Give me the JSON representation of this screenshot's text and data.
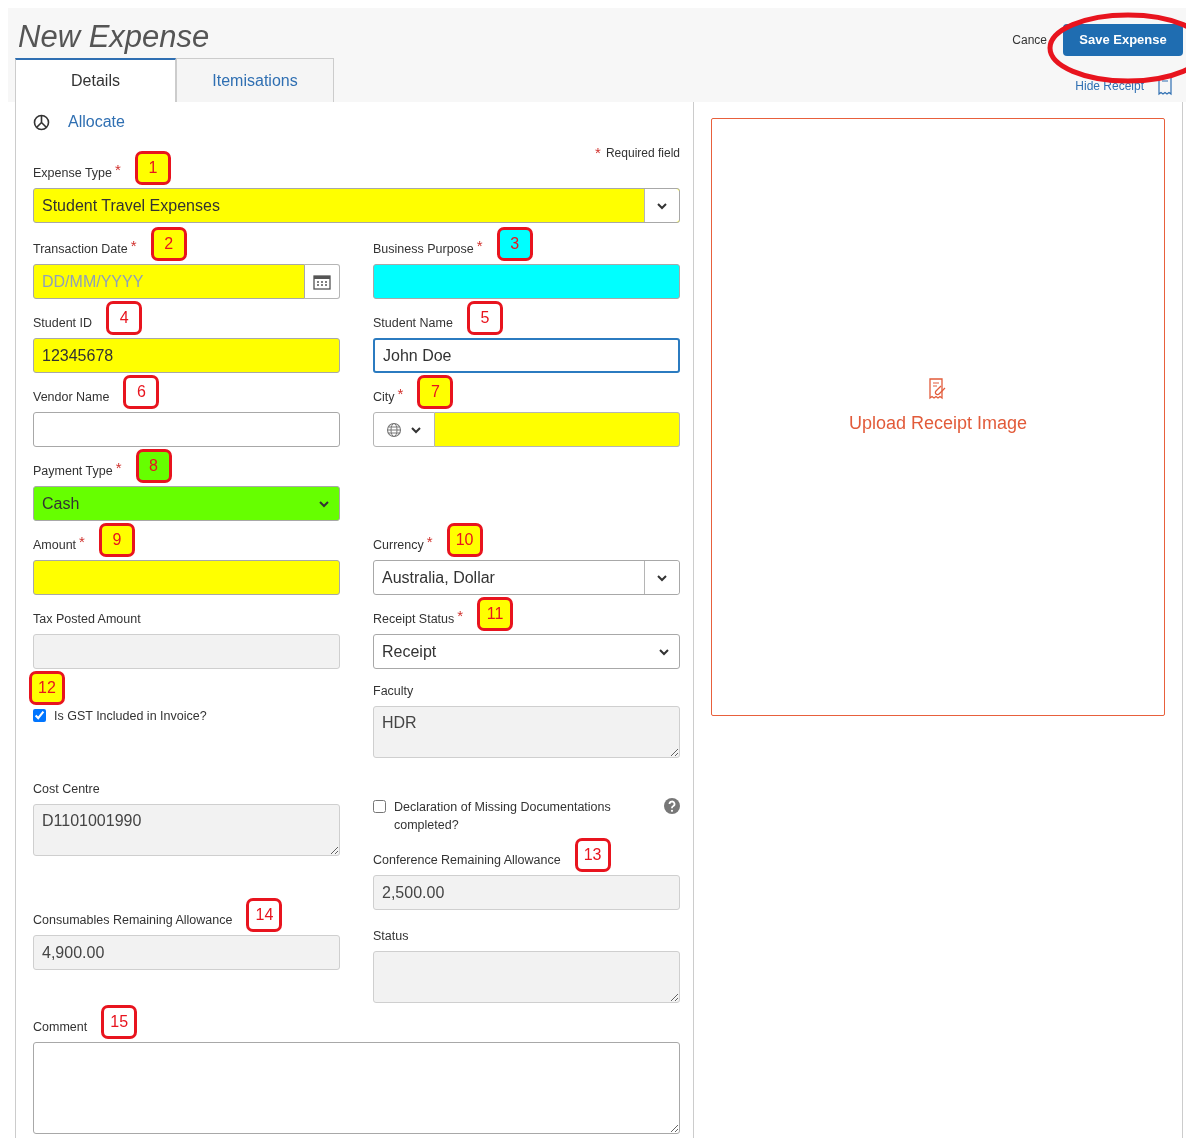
{
  "header": {
    "title": "New Expense",
    "cancel": "Cance",
    "save": {
      "label": "Save Expense",
      "circled": true
    },
    "hide_receipt": "Hide Receipt"
  },
  "tabs": [
    {
      "label": "Details",
      "selected": true
    },
    {
      "label": "Itemisations",
      "selected": false
    }
  ],
  "allocate": "Allocate",
  "required_note": {
    "asterisk": "*",
    "text": "Required field"
  },
  "form": {
    "top": [
      {
        "label": "Expense Type",
        "asterisk": "*",
        "kind": "combo",
        "value": "Student Travel Expenses",
        "color": "#ffff00",
        "disabled": false,
        "focused": false,
        "badge": {
          "label": "1",
          "color": "#ffff00"
        }
      }
    ],
    "pairs": [
      [
        {
          "label": "Transaction Date",
          "asterisk": "*",
          "kind": "date",
          "placeholder": "DD/MM/YYYY",
          "color": "#ffff00",
          "disabled": false,
          "focused": false,
          "badge": {
            "label": "2",
            "color": "#ffff00"
          }
        },
        {
          "label": "Business Purpose",
          "asterisk": "*",
          "kind": "text",
          "color": "#00ffff",
          "disabled": false,
          "focused": false,
          "badge": {
            "label": "3",
            "color": "#00ffff"
          }
        }
      ],
      [
        {
          "label": "Student ID",
          "kind": "text",
          "value": "12345678",
          "color": "#ffff00",
          "disabled": false,
          "focused": false,
          "badge": {
            "label": "4",
            "color": "#ffffff"
          }
        },
        {
          "label": "Student Name",
          "kind": "text",
          "value": "John Doe",
          "disabled": false,
          "focused": true,
          "badge": {
            "label": "5",
            "color": "#ffffff"
          }
        }
      ],
      [
        {
          "label": "Vendor Name",
          "kind": "text",
          "disabled": false,
          "focused": false,
          "badge": {
            "label": "6",
            "color": "#ffffff"
          }
        },
        {
          "label": "City",
          "asterisk": "*",
          "kind": "city",
          "color": "#ffff00",
          "disabled": false,
          "focused": false,
          "badge": {
            "label": "7",
            "color": "#ffff00"
          }
        }
      ],
      [
        {
          "label": "Payment Type",
          "asterisk": "*",
          "kind": "select",
          "value": "Cash",
          "color": "#66ff00",
          "disabled": false,
          "focused": false,
          "badge": {
            "label": "8",
            "color": "#66ff00"
          }
        }
      ],
      [
        {
          "label": "Amount",
          "asterisk": "*",
          "kind": "text",
          "color": "#ffff00",
          "disabled": false,
          "focused": false,
          "badge": {
            "label": "9",
            "color": "#ffff00"
          }
        },
        {
          "label": "Currency",
          "asterisk": "*",
          "kind": "combo",
          "value": "Australia, Dollar",
          "disabled": false,
          "focused": false,
          "badge": {
            "label": "10",
            "color": "#ffff00"
          }
        }
      ],
      [
        {
          "label": "Tax Posted Amount",
          "kind": "text",
          "disabled": true,
          "focused": false
        },
        {
          "label": "Receipt Status",
          "asterisk": "*",
          "kind": "select",
          "value": "Receipt",
          "disabled": false,
          "focused": false,
          "badge": {
            "label": "11",
            "color": "#ffff00"
          }
        }
      ]
    ],
    "left_stack": [
      {
        "kind": "checkbox",
        "text": "Is GST Included in Invoice?",
        "checked": true,
        "badge": {
          "label": "12",
          "color": "#ffff00"
        }
      },
      {
        "label": "Cost Centre",
        "kind": "textarea",
        "value": "D1101001990",
        "disabled": true,
        "focused": false
      },
      {
        "label": "Consumables Remaining Allowance",
        "kind": "text",
        "value": "4,900.00",
        "disabled": true,
        "focused": false,
        "badge": {
          "label": "14",
          "color": "#ffffff"
        }
      }
    ],
    "right_stack": [
      {
        "label": "Faculty",
        "kind": "textarea",
        "value": "HDR",
        "disabled": true,
        "focused": false
      },
      {
        "kind": "checkbox",
        "text": "Declaration of Missing Documentations completed?",
        "checked": false,
        "help": true
      },
      {
        "label": "Conference Remaining Allowance",
        "kind": "text",
        "value": "2,500.00",
        "disabled": true,
        "focused": false,
        "badge": {
          "label": "13",
          "color": "#ffffff"
        }
      },
      {
        "label": "Status",
        "kind": "textarea",
        "disabled": true,
        "focused": false
      }
    ],
    "bottom": [
      {
        "label": "Comment",
        "kind": "textarea",
        "disabled": false,
        "focused": false,
        "badge": {
          "label": "15",
          "color": "#ffffff"
        }
      }
    ]
  },
  "receipt_panel": {
    "label": "Upload Receipt Image"
  }
}
